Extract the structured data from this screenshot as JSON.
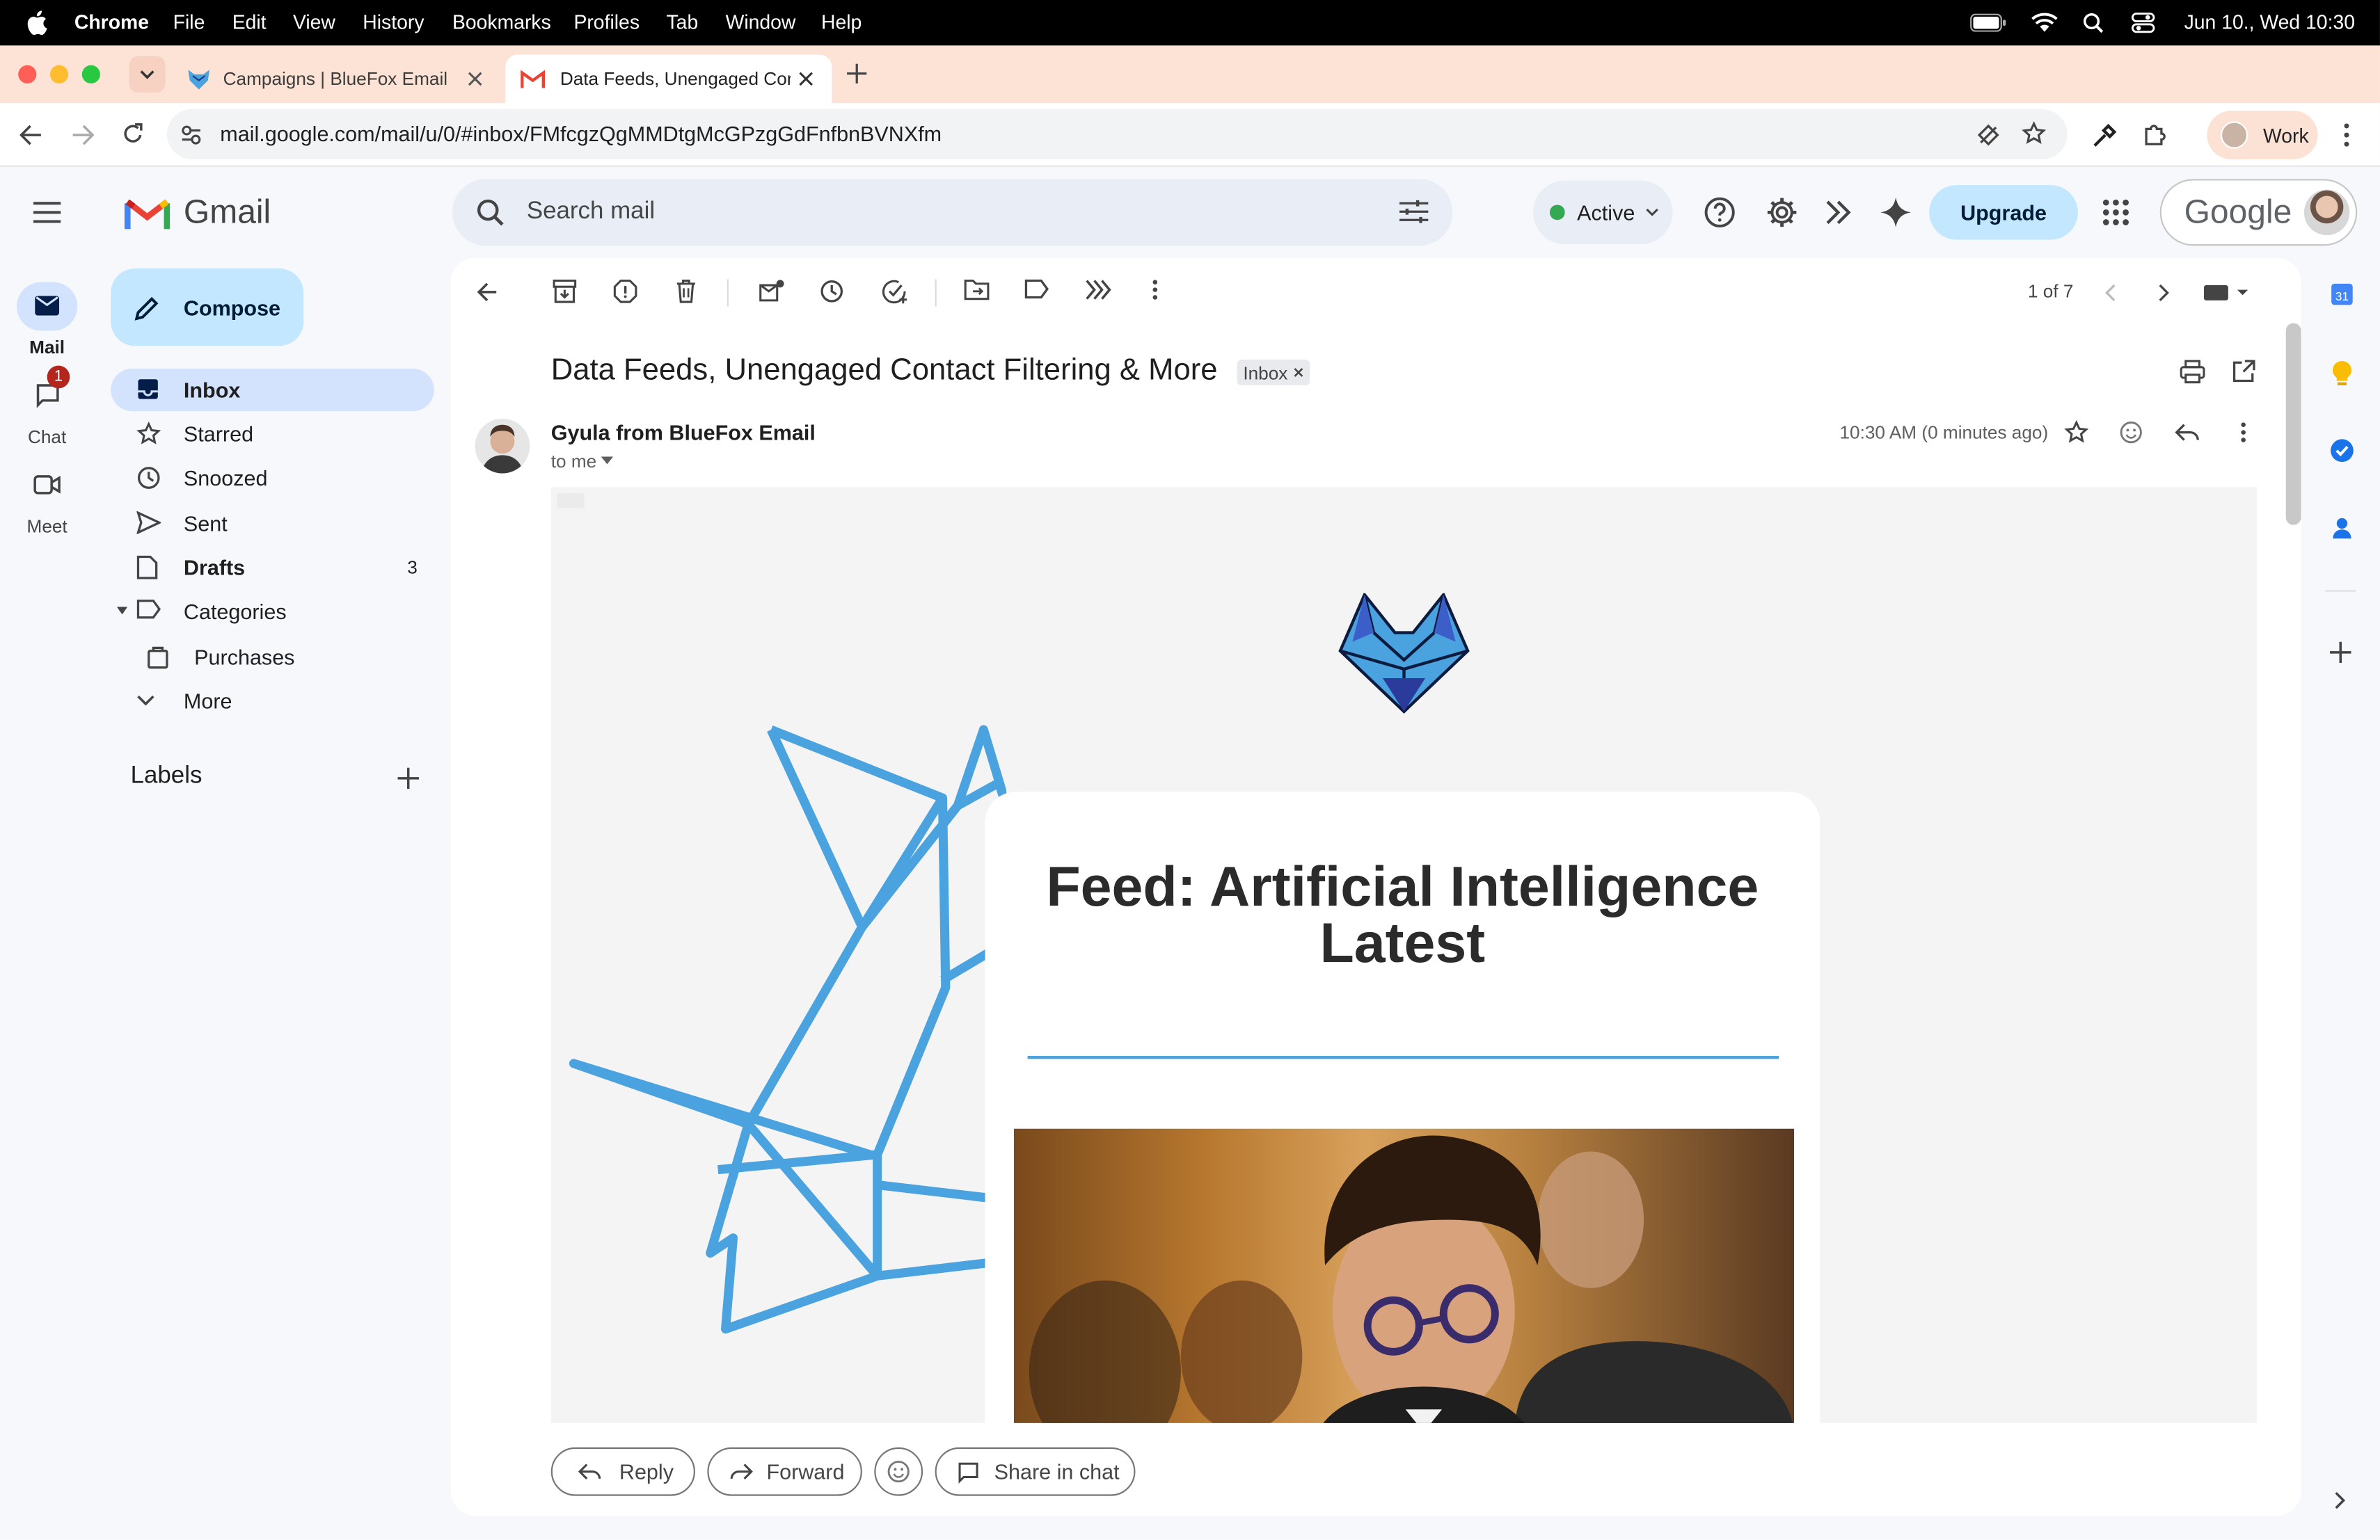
{
  "menubar": {
    "app": "Chrome",
    "items": [
      "File",
      "Edit",
      "View",
      "History",
      "Bookmarks",
      "Profiles",
      "Tab",
      "Window",
      "Help"
    ],
    "datetime": "Jun 10., Wed  10:30"
  },
  "tabs": [
    {
      "title": "Campaigns | BlueFox Email",
      "icon": "bluefox-icon"
    },
    {
      "title": "Data Feeds, Unengaged Cont",
      "icon": "gmail-icon"
    }
  ],
  "browser": {
    "url": "mail.google.com/mail/u/0/#inbox/FMfcgzQgMMDtgMcGPzgGdFnfbnBVNXfm",
    "profile": "Work"
  },
  "gmail": {
    "logo_text": "Gmail",
    "search_placeholder": "Search mail",
    "status": "Active",
    "upgrade": "Upgrade",
    "google_text": "Google",
    "compose": "Compose",
    "rail": {
      "mail": "Mail",
      "chat": "Chat",
      "chat_badge": "1",
      "meet": "Meet"
    },
    "nav": [
      {
        "label": "Inbox",
        "count": ""
      },
      {
        "label": "Starred",
        "count": ""
      },
      {
        "label": "Snoozed",
        "count": ""
      },
      {
        "label": "Sent",
        "count": ""
      },
      {
        "label": "Drafts",
        "count": "3"
      },
      {
        "label": "Categories",
        "count": ""
      },
      {
        "label": "Purchases",
        "count": ""
      },
      {
        "label": "More",
        "count": ""
      }
    ],
    "labels_heading": "Labels",
    "pagination": "1 of 7"
  },
  "email": {
    "subject": "Data Feeds, Unengaged Contact Filtering & More",
    "label_chip": "Inbox",
    "sender": "Gyula from BlueFox Email",
    "to": "to me",
    "time": "10:30 AM (0 minutes ago)",
    "body_heading": "Feed: Artificial Intelligence Latest"
  },
  "actions": {
    "reply": "Reply",
    "forward": "Forward",
    "share": "Share in chat"
  },
  "colors": {
    "accent": "#0b57d0",
    "selected": "#d3e3fd",
    "bluefox": "#4aa3df",
    "tabstrip": "#fde3d6"
  }
}
